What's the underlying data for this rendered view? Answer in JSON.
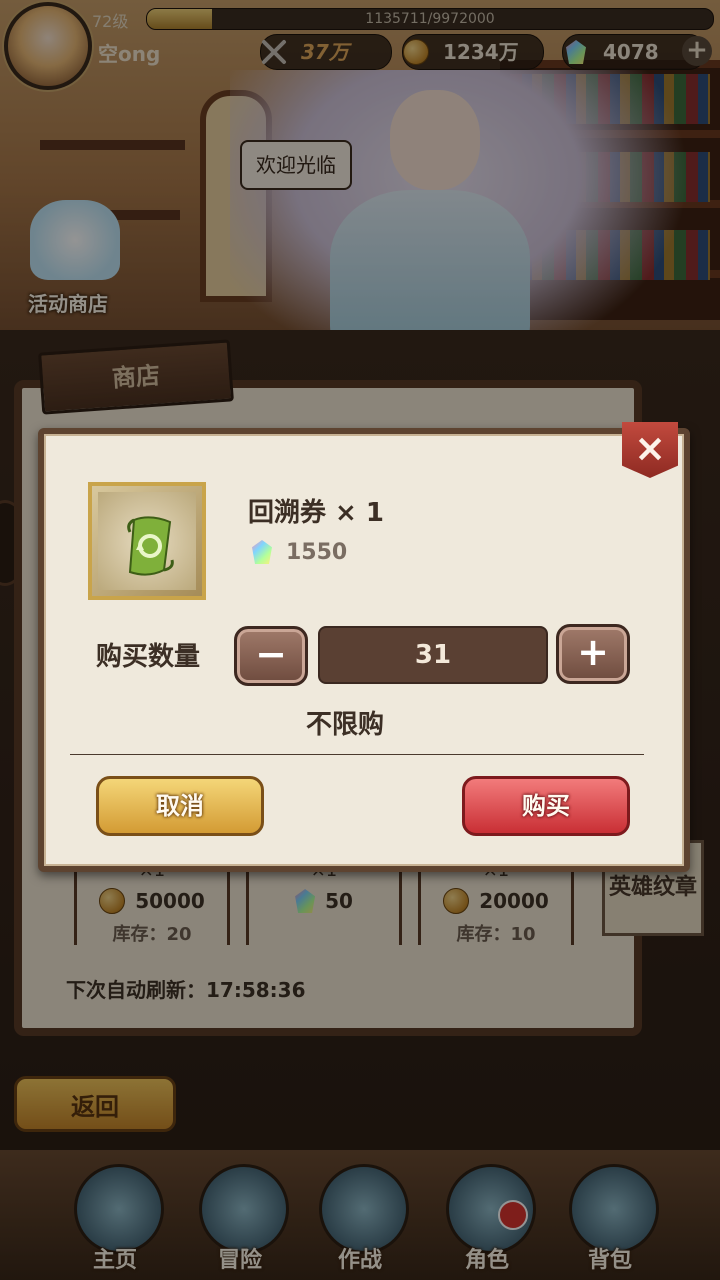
{
  "hud": {
    "level": "72级",
    "exp_text": "1135711/9972000",
    "exp_progress": 0.114,
    "player_name": "空ong",
    "power": "37万",
    "gold": "1234万",
    "gems": "4078",
    "plus_label": "+"
  },
  "scene": {
    "welcome_text": "欢迎光临",
    "event_shop_label": "活动商店",
    "shop_tab_label": "商店",
    "refresh_label": "下次自动刷新：17:58:36",
    "side_tab_label": "英雄纹章",
    "back_label": "返回",
    "cards": [
      {
        "qty": "×1",
        "price": "50000",
        "currency": "gold",
        "stock": "库存：20"
      },
      {
        "qty": "×1",
        "price": "50",
        "currency": "gem",
        "stock": ""
      },
      {
        "qty": "×1",
        "price": "20000",
        "currency": "gold",
        "stock": "库存：10"
      }
    ]
  },
  "nav": [
    {
      "label": "主页",
      "badge": false
    },
    {
      "label": "冒险",
      "badge": false
    },
    {
      "label": "作战",
      "badge": false
    },
    {
      "label": "角色",
      "badge": true
    },
    {
      "label": "背包",
      "badge": false
    }
  ],
  "dialog": {
    "item_name": "回溯券 × 1",
    "item_price": "1550",
    "qty_label": "购买数量",
    "quantity": "31",
    "minus_label": "−",
    "plus_label": "+",
    "limit_text": "不限购",
    "cancel_label": "取消",
    "buy_label": "购买",
    "close_label": "×",
    "item_icon": "scroll-icon",
    "price_icon": "gem-icon"
  },
  "colors": {
    "dialog_bg": "#efe9dc",
    "buy_red": "#c92f35",
    "cancel_gold": "#d39b34"
  }
}
